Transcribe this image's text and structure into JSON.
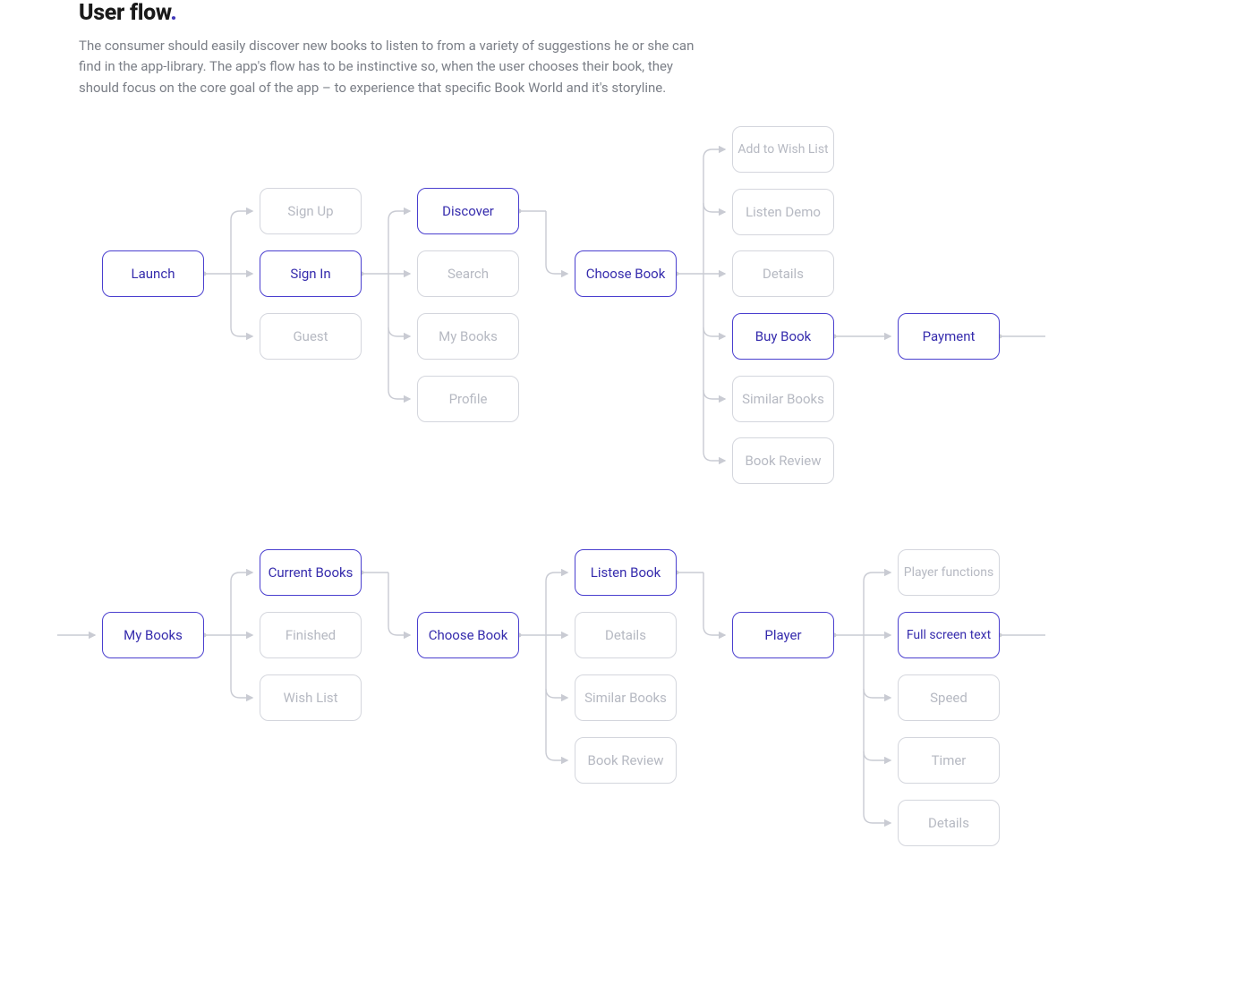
{
  "heading": {
    "title": "User flow",
    "dot": "."
  },
  "description": "The consumer should easily discover new books to listen to from a variety of suggestions he or she can find in the app-library. The app's flow has to be instinctive so, when the user chooses their book, they should focus on the core goal of the app – to experience that specific Book World and it's storyline.",
  "flow1": {
    "c1": {
      "launch": "Launch"
    },
    "c2": {
      "signup": "Sign Up",
      "signin": "Sign In",
      "guest": "Guest"
    },
    "c3": {
      "discover": "Discover",
      "search": "Search",
      "mybooks": "My Books",
      "profile": "Profile"
    },
    "c4": {
      "choose": "Choose Book"
    },
    "c5": {
      "wish": "Add to Wish List",
      "demo": "Listen Demo",
      "details": "Details",
      "buy": "Buy Book",
      "similar": "Similar Books",
      "review": "Book Review"
    },
    "c6": {
      "payment": "Payment"
    }
  },
  "flow2": {
    "c1": {
      "mybooks": "My Books"
    },
    "c2": {
      "current": "Current Books",
      "finished": "Finished",
      "wish": "Wish List"
    },
    "c3": {
      "choose": "Choose Book"
    },
    "c4": {
      "listen": "Listen Book",
      "details": "Details",
      "similar": "Similar Books",
      "review": "Book Review"
    },
    "c5": {
      "player": "Player"
    },
    "c6": {
      "func": "Player functions",
      "full": "Full screen text",
      "speed": "Speed",
      "timer": "Timer",
      "details": "Details"
    }
  }
}
